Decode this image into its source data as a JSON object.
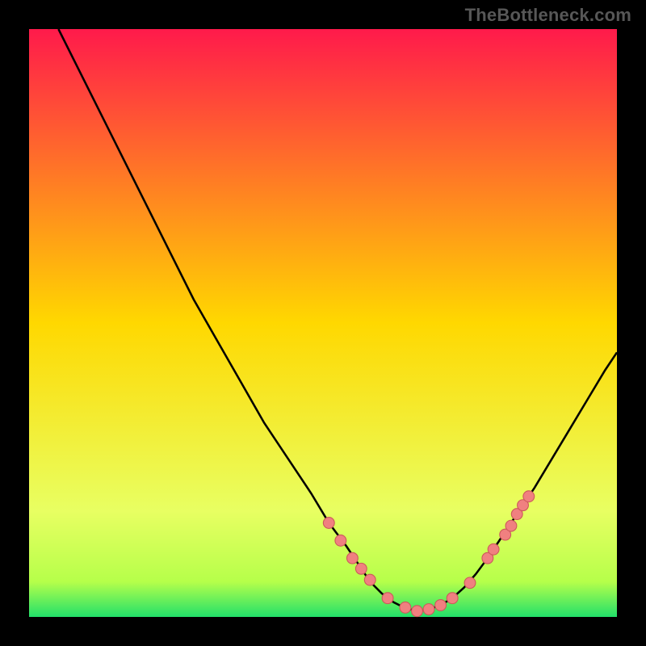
{
  "watermark": "TheBottleneck.com",
  "colors": {
    "background": "#000000",
    "gradient_top": "#ff1a4b",
    "gradient_mid": "#ffd800",
    "gradient_low": "#e8ff62",
    "band_yellowgreen": "#b6ff4a",
    "band_green": "#22e06a",
    "curve": "#000000",
    "marker_fill": "#f08080",
    "marker_stroke": "#cc5a5a"
  },
  "chart_data": {
    "type": "line",
    "title": "",
    "xlabel": "",
    "ylabel": "",
    "xlim": [
      0,
      100
    ],
    "ylim": [
      0,
      100
    ],
    "series": [
      {
        "name": "bottleneck-curve",
        "x": [
          5,
          8,
          12,
          16,
          20,
          24,
          28,
          32,
          36,
          40,
          44,
          48,
          51,
          54,
          56,
          58,
          60,
          62,
          64,
          66,
          68,
          70,
          72,
          74,
          76,
          78,
          80,
          83,
          86,
          89,
          92,
          95,
          98,
          100
        ],
        "y": [
          100,
          94,
          86,
          78,
          70,
          62,
          54,
          47,
          40,
          33,
          27,
          21,
          16,
          12,
          9,
          6,
          4,
          2.5,
          1.5,
          1,
          1.3,
          2,
          3.2,
          5,
          7.3,
          10,
          13,
          17.5,
          22,
          27,
          32,
          37,
          42,
          45
        ]
      }
    ],
    "markers": {
      "name": "highlight-points",
      "x": [
        51,
        53,
        55,
        56.5,
        58,
        61,
        64,
        66,
        68,
        70,
        72,
        75,
        78,
        79,
        81,
        82,
        83,
        84,
        85
      ],
      "y": [
        16,
        13,
        10,
        8.2,
        6.3,
        3.2,
        1.6,
        1,
        1.3,
        2,
        3.2,
        5.8,
        10,
        11.5,
        14,
        15.5,
        17.5,
        19,
        20.5
      ]
    },
    "bands": [
      {
        "name": "yellow-green",
        "y_from": 0,
        "y_to": 12
      },
      {
        "name": "green",
        "y_from": 0,
        "y_to": 2.5
      }
    ]
  }
}
